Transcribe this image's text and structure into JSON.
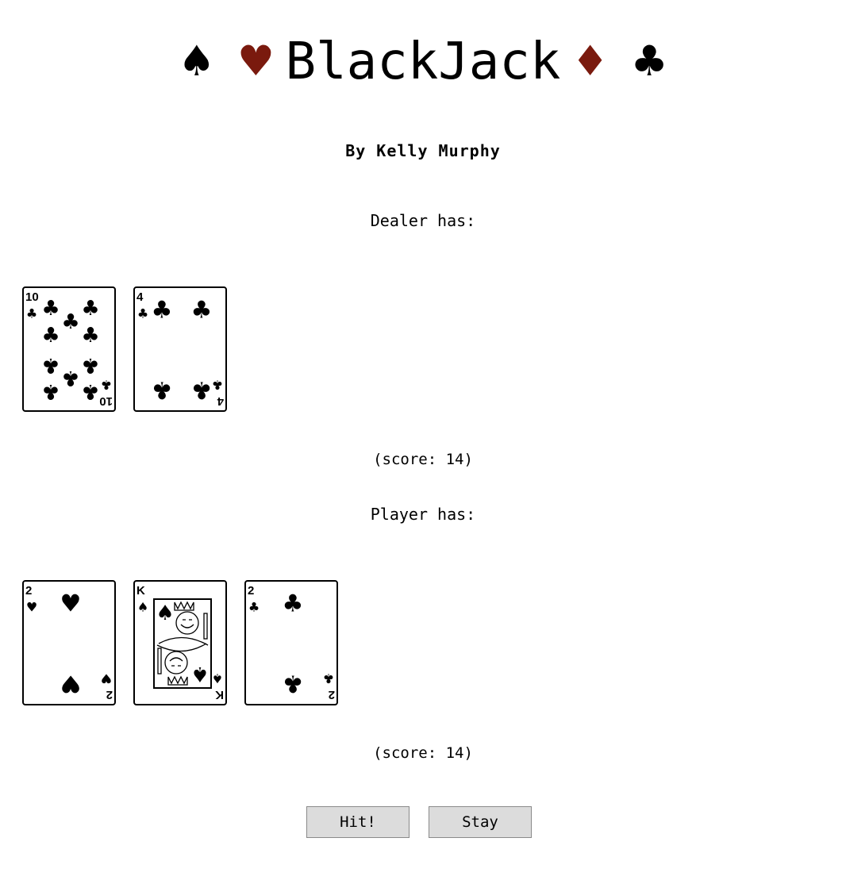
{
  "title": {
    "text": "BlackJack",
    "suits_left": [
      "♠",
      "♥"
    ],
    "suits_right": [
      "♦",
      "♣"
    ]
  },
  "byline": "By Kelly Murphy",
  "dealer": {
    "label": "Dealer has:",
    "score_text": "(score: 14)",
    "cards": [
      {
        "rank": "10",
        "suit": "clubs",
        "symbol": "♣"
      },
      {
        "rank": "4",
        "suit": "clubs",
        "symbol": "♣"
      }
    ]
  },
  "player": {
    "label": "Player has:",
    "score_text": "(score: 14)",
    "cards": [
      {
        "rank": "2",
        "suit": "hearts",
        "symbol": "♥"
      },
      {
        "rank": "K",
        "suit": "spades",
        "symbol": "♠"
      },
      {
        "rank": "2",
        "suit": "clubs",
        "symbol": "♣"
      }
    ]
  },
  "buttons": {
    "hit_label": "Hit!",
    "stay_label": "Stay"
  },
  "colors": {
    "red_suit": "#7a1a0e",
    "black_suit": "#000000",
    "button_bg": "#dcdcdc"
  }
}
